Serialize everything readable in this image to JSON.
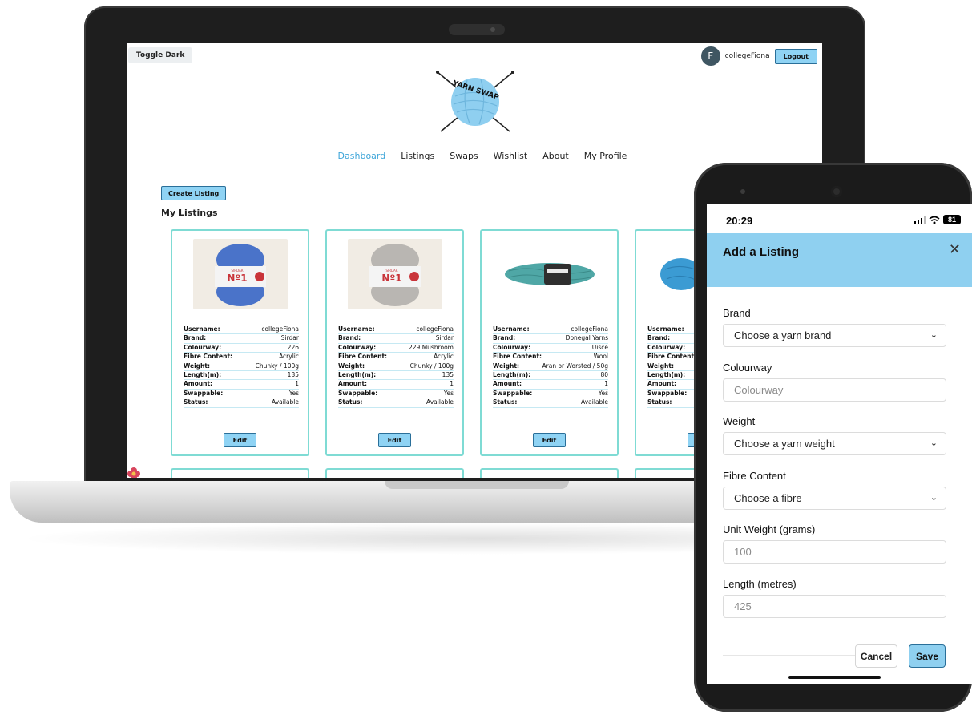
{
  "web": {
    "toggle_dark": "Toggle Dark",
    "user": {
      "avatar_initial": "F",
      "username": "collegeFiona"
    },
    "logout": "Logout",
    "logo_text": "YARN SWAP",
    "nav": [
      {
        "label": "Dashboard",
        "active": true
      },
      {
        "label": "Listings"
      },
      {
        "label": "Swaps"
      },
      {
        "label": "Wishlist"
      },
      {
        "label": "About"
      },
      {
        "label": "My Profile"
      }
    ],
    "create_listing": "Create Listing",
    "section_title": "My Listings",
    "field_labels": {
      "username": "Username:",
      "brand": "Brand:",
      "colourway": "Colourway:",
      "fibre": "Fibre Content:",
      "weight": "Weight:",
      "length": "Length(m):",
      "amount": "Amount:",
      "swappable": "Swappable:",
      "status": "Status:"
    },
    "edit_label": "Edit",
    "listings": [
      {
        "username": "collegeFiona",
        "brand": "Sirdar",
        "colourway": "226",
        "fibre": "Acrylic",
        "weight": "Chunky / 100g",
        "length": "135",
        "amount": "1",
        "swappable": "Yes",
        "status": "Available",
        "image": "blue-yarn-ball",
        "image_label": "Nº1",
        "image_brand": "SIRDAR",
        "color": "#4a73c9"
      },
      {
        "username": "collegeFiona",
        "brand": "Sirdar",
        "colourway": "229 Mushroom",
        "fibre": "Acrylic",
        "weight": "Chunky / 100g",
        "length": "135",
        "amount": "1",
        "swappable": "Yes",
        "status": "Available",
        "image": "grey-yarn-ball",
        "image_label": "Nº1",
        "image_brand": "SIRDAR",
        "color": "#b9b6b2"
      },
      {
        "username": "collegeFiona",
        "brand": "Donegal Yarns",
        "colourway": "Uisce",
        "fibre": "Wool",
        "weight": "Aran or Worsted / 50g",
        "length": "80",
        "amount": "1",
        "swappable": "Yes",
        "status": "Available",
        "image": "teal-yarn-skein",
        "color": "#4fa7a6"
      },
      {
        "username": "",
        "brand": "",
        "colourway": "",
        "fibre": "",
        "weight": "",
        "length": "",
        "amount": "",
        "swappable": "",
        "status": "",
        "image": "turquoise-yarn",
        "color": "#3b9bd3"
      }
    ]
  },
  "phone": {
    "time": "20:29",
    "battery": "81",
    "modal_title": "Add a Listing",
    "fields": [
      {
        "label": "Brand",
        "value": "Choose a yarn brand",
        "type": "select"
      },
      {
        "label": "Colourway",
        "placeholder": "Colourway",
        "type": "input"
      },
      {
        "label": "Weight",
        "value": "Choose a yarn weight",
        "type": "select"
      },
      {
        "label": "Fibre Content",
        "value": "Choose a fibre",
        "type": "select"
      },
      {
        "label": "Unit Weight (grams)",
        "placeholder": "100",
        "type": "input"
      },
      {
        "label": "Length (metres)",
        "placeholder": "425",
        "type": "input"
      }
    ],
    "cancel": "Cancel",
    "save": "Save"
  }
}
